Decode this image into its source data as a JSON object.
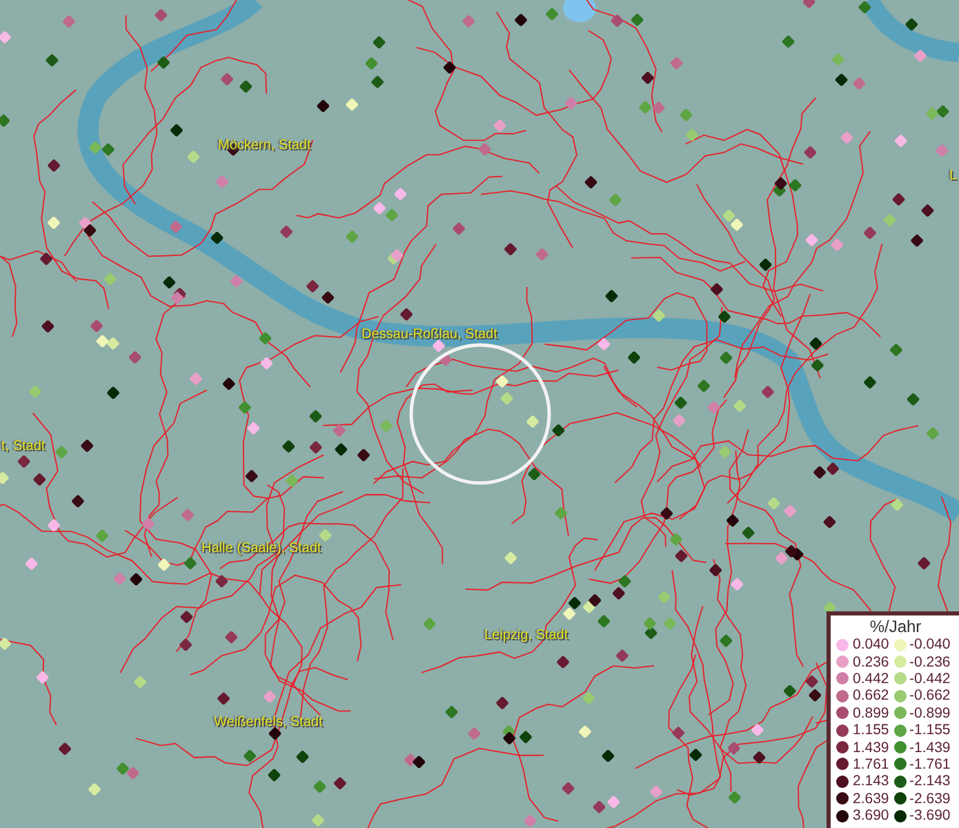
{
  "map_labels": [
    {
      "text": "Möckern, Stadt"
    },
    {
      "text": "Dessau-Roßlau, Stadt"
    },
    {
      "text": "t, Stadt"
    },
    {
      "text": "Halle (Saale), Stadt"
    },
    {
      "text": "Leipzig, Stadt"
    },
    {
      "text": "Weißenfels, Stadt"
    },
    {
      "text": "L"
    }
  ],
  "legend": {
    "title": "%/Jahr",
    "column_1": [
      {
        "value": "0.040",
        "color": "#f8b8e8"
      },
      {
        "value": "0.236",
        "color": "#e8a0c8"
      },
      {
        "value": "0.442",
        "color": "#d07fa8"
      },
      {
        "value": "0.662",
        "color": "#c06a8e"
      },
      {
        "value": "0.899",
        "color": "#a84d70"
      },
      {
        "value": "1.155",
        "color": "#943a58"
      },
      {
        "value": "1.439",
        "color": "#7a2740"
      },
      {
        "value": "1.761",
        "color": "#651a30"
      },
      {
        "value": "2.143",
        "color": "#4e1020"
      },
      {
        "value": "2.639",
        "color": "#380a14"
      },
      {
        "value": "3.690",
        "color": "#22040a"
      }
    ],
    "column_2": [
      {
        "value": "-0.040",
        "color": "#f0f5b8"
      },
      {
        "value": "-0.236",
        "color": "#d6eba0"
      },
      {
        "value": "-0.442",
        "color": "#b5da88"
      },
      {
        "value": "-0.662",
        "color": "#98ca70"
      },
      {
        "value": "-0.899",
        "color": "#7ab85a"
      },
      {
        "value": "-1.155",
        "color": "#5ea544"
      },
      {
        "value": "-1.439",
        "color": "#428f30"
      },
      {
        "value": "-1.761",
        "color": "#2d7622"
      },
      {
        "value": "-2.143",
        "color": "#1c5c16"
      },
      {
        "value": "-2.639",
        "color": "#10420c"
      },
      {
        "value": "-3.690",
        "color": "#062a06"
      }
    ]
  }
}
